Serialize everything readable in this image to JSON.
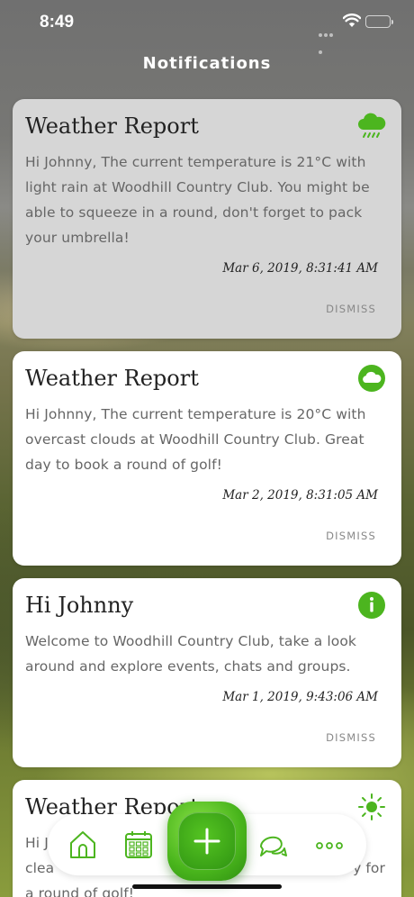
{
  "status_bar": {
    "time": "8:49"
  },
  "header": {
    "title": "Notifications"
  },
  "notifications": [
    {
      "title": "Weather Report",
      "icon": "rain-cloud-icon",
      "message": "Hi Johnny, The current temperature is 21°C with light rain at Woodhill Country Club. You might be able to squeeze in a round, don't forget to pack your umbrella!",
      "date": "Mar 6, 2019, 8:31:41 AM",
      "dismiss_label": "DISMISS"
    },
    {
      "title": "Weather Report",
      "icon": "cloud-icon",
      "message": "Hi Johnny, The current temperature is 20°C with overcast clouds at Woodhill Country Club. Great day to book a round of golf!",
      "date": "Mar 2, 2019, 8:31:05 AM",
      "dismiss_label": "DISMISS"
    },
    {
      "title": "Hi Johnny",
      "icon": "info-icon",
      "message": "Welcome to Woodhill Country Club, take a look around and explore events, chats and groups.",
      "date": "Mar 1, 2019, 9:43:06 AM",
      "dismiss_label": "DISMISS"
    },
    {
      "title": "Weather Report",
      "icon": "sun-icon",
      "message_line1": "Hi J",
      "message_line2a": "clea",
      "message_line2b": "y for",
      "message_line3": "a round of golf!"
    }
  ],
  "tab_bar": {
    "items": [
      "home-icon",
      "calendar-icon",
      "add-icon",
      "chat-icon",
      "more-icon"
    ]
  },
  "colors": {
    "accent": "#4cb51f",
    "read_card": "#d6d6d6",
    "card": "#ffffff"
  }
}
